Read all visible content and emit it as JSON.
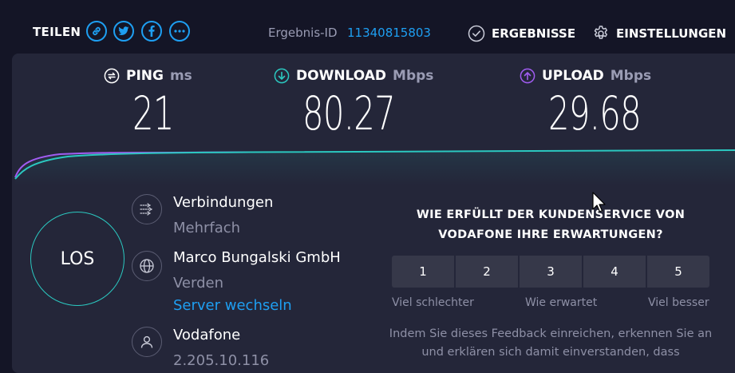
{
  "header": {
    "share_label": "TEILEN",
    "share_icons": [
      "link-icon",
      "twitter-icon",
      "facebook-icon",
      "more-icon"
    ],
    "result_label": "Ergebnis-ID",
    "result_id": "11340815803",
    "results_label": "ERGEBNISSE",
    "settings_label": "EINSTELLUNGEN"
  },
  "metrics": {
    "ping": {
      "label": "PING",
      "unit": "ms",
      "value": "21"
    },
    "download": {
      "label": "DOWNLOAD",
      "unit": "Mbps",
      "value": "80.27"
    },
    "upload": {
      "label": "UPLOAD",
      "unit": "Mbps",
      "value": "29.68"
    }
  },
  "colors": {
    "accent": "#1e9ff2",
    "download": "#2bc8c0",
    "upload": "#a05cf0",
    "background": "#141526",
    "panel": "#242639"
  },
  "start_button": {
    "label": "LOS"
  },
  "connection": {
    "connections_title": "Verbindungen",
    "connections_value": "Mehrfach",
    "server_name": "Marco Bungalski GmbH",
    "server_location": "Verden",
    "change_server": "Server wechseln",
    "isp_name": "Vodafone",
    "isp_ip": "2.205.10.116"
  },
  "survey": {
    "question": "WIE ERFÜLLT DER KUNDENSERVICE VON VODAFONE IHRE ERWARTUNGEN?",
    "ratings": [
      "1",
      "2",
      "3",
      "4",
      "5"
    ],
    "scale_low": "Viel schlechter",
    "scale_mid": "Wie erwartet",
    "scale_high": "Viel besser",
    "disclaimer": "Indem Sie dieses Feedback einreichen, erkennen Sie an und erklären sich damit einverstanden, dass"
  }
}
